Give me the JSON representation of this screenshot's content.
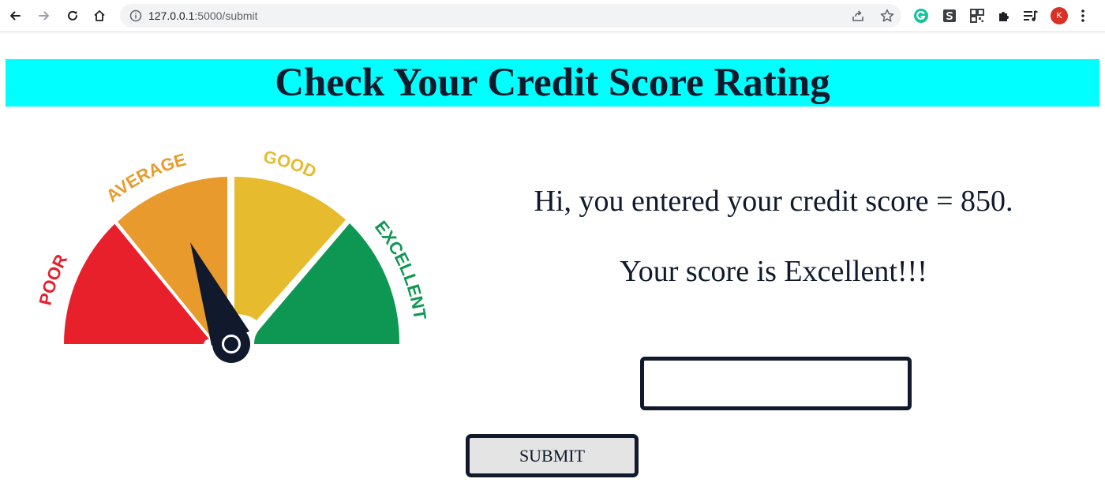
{
  "browser": {
    "url_host": "127.0.0.1",
    "url_path": ":5000/submit",
    "profile_initial": "K"
  },
  "page": {
    "title": "Check Your Credit Score Rating",
    "score_message": "Hi, you entered your credit score = 850.",
    "rating_message": "Your score is Excellent!!!",
    "input": {
      "value": "",
      "placeholder": ""
    },
    "submit_label": "SUBMIT"
  },
  "gauge": {
    "labels": [
      "POOR",
      "AVERAGE",
      "GOOD",
      "EXCELLENT"
    ],
    "colors": {
      "poor": "#e8202b",
      "average": "#e89b2c",
      "good": "#e6bb2e",
      "excellent": "#0e9752",
      "needle": "#101a2c"
    }
  },
  "colors": {
    "banner": "#00ffff",
    "text": "#101a2c"
  }
}
